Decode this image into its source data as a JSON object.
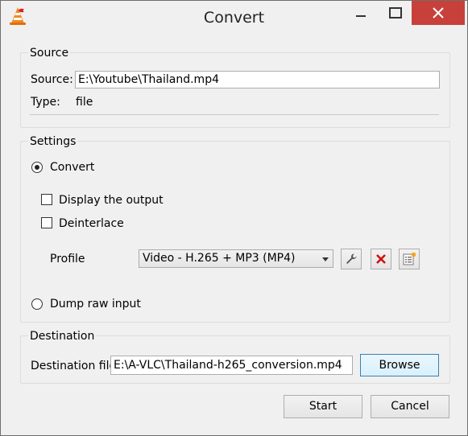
{
  "window": {
    "title": "Convert"
  },
  "source": {
    "group_title": "Source",
    "source_label": "Source:",
    "source_value": "E:\\Youtube\\Thailand.mp4",
    "type_label": "Type:",
    "type_value": "file"
  },
  "settings": {
    "group_title": "Settings",
    "convert_label": "Convert",
    "convert_checked": true,
    "display_output_label": "Display the output",
    "deinterlace_label": "Deinterlace",
    "profile_label": "Profile",
    "profile_selected": "Video - H.265 + MP3 (MP4)",
    "dump_raw_label": "Dump raw input"
  },
  "destination": {
    "group_title": "Destination",
    "file_label": "Destination file:",
    "file_value": "E:\\A-VLC\\Thailand-h265_conversion.mp4",
    "browse_label": "Browse"
  },
  "footer": {
    "start_label": "Start",
    "cancel_label": "Cancel"
  },
  "icons": {
    "app": "vlc-cone-icon",
    "edit_profile": "wrench-icon",
    "delete_profile": "red-x-icon",
    "new_profile": "new-profile-icon"
  },
  "colors": {
    "close_button": "#c7403a",
    "delete_icon": "#d01010",
    "default_button_border": "#3c7fb1"
  }
}
